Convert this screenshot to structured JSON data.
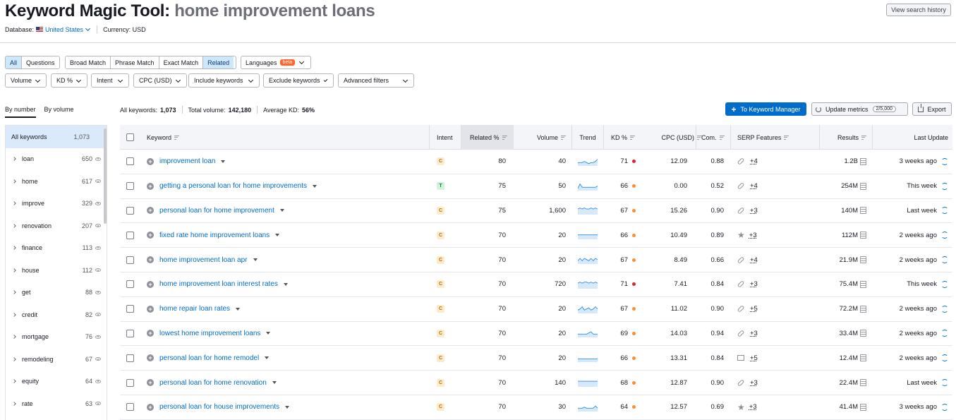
{
  "header": {
    "title_prefix": "Keyword Magic Tool:",
    "title_query": "home improvement loans",
    "database_label": "Database:",
    "database_value": "United States",
    "currency_label": "Currency: USD",
    "history_button": "View search history"
  },
  "match_tabs": [
    {
      "label": "All",
      "active": true
    },
    {
      "label": "Questions",
      "active": false
    }
  ],
  "match_types": [
    {
      "label": "Broad Match",
      "active": false
    },
    {
      "label": "Phrase Match",
      "active": false
    },
    {
      "label": "Exact Match",
      "active": false
    },
    {
      "label": "Related",
      "active": true
    }
  ],
  "languages": {
    "label": "Languages",
    "badge": "beta"
  },
  "filters": [
    "Volume",
    "KD %",
    "Intent",
    "CPC (USD)",
    "Include keywords",
    "Exclude keywords",
    "Advanced filters"
  ],
  "group_tabs": [
    {
      "label": "By number",
      "active": true
    },
    {
      "label": "By volume",
      "active": false
    }
  ],
  "sidebar": {
    "all": {
      "label": "All keywords",
      "count": "1,073"
    },
    "items": [
      {
        "label": "loan",
        "count": "650"
      },
      {
        "label": "home",
        "count": "617"
      },
      {
        "label": "improve",
        "count": "329"
      },
      {
        "label": "renovation",
        "count": "207"
      },
      {
        "label": "finance",
        "count": "113"
      },
      {
        "label": "house",
        "count": "112"
      },
      {
        "label": "get",
        "count": "88"
      },
      {
        "label": "credit",
        "count": "82"
      },
      {
        "label": "mortgage",
        "count": "76"
      },
      {
        "label": "remodeling",
        "count": "67"
      },
      {
        "label": "equity",
        "count": "64"
      },
      {
        "label": "rate",
        "count": "63"
      }
    ]
  },
  "stats": {
    "all_label": "All keywords:",
    "all_value": "1,073",
    "volume_label": "Total volume:",
    "volume_value": "142,180",
    "kd_label": "Average KD:",
    "kd_value": "56%"
  },
  "actions": {
    "keyword_manager": "To Keyword Manager",
    "update_metrics": "Update metrics",
    "update_count": "2/5,000",
    "export": "Export"
  },
  "columns": {
    "keyword": "Keyword",
    "intent": "Intent",
    "related": "Related %",
    "volume": "Volume",
    "trend": "Trend",
    "kd": "KD %",
    "cpc": "CPC (USD)",
    "com": "Com.",
    "serp": "SERP Features",
    "results": "Results",
    "last_update": "Last Update"
  },
  "colors": {
    "accent": "#006dca",
    "intent_c_bg": "#fcecce",
    "intent_c_fg": "#b57000",
    "intent_t_bg": "#d2f2dc",
    "intent_t_fg": "#00873c",
    "kd_red": "#e0213a",
    "kd_orange": "#ff8c2e"
  },
  "rows": [
    {
      "keyword": "improvement loan",
      "intent": "C",
      "related": "80",
      "volume": "40",
      "kd": "71",
      "kd_level": "red",
      "cpc": "12.09",
      "com": "0.88",
      "serp_icon": "link-icon",
      "serp_more": "+4",
      "results": "1.2B",
      "updated": "3 weeks ago",
      "trend": [
        3,
        3,
        3,
        4,
        3,
        2,
        3,
        3,
        4,
        6
      ]
    },
    {
      "keyword": "getting a personal loan for home improvements",
      "intent": "T",
      "related": "75",
      "volume": "50",
      "kd": "66",
      "kd_level": "orange",
      "cpc": "0.00",
      "com": "0.52",
      "serp_icon": "link-icon",
      "serp_more": "+4",
      "results": "254M",
      "updated": "This week",
      "trend": [
        2,
        6,
        3,
        3,
        3,
        3,
        3,
        3,
        3,
        4
      ]
    },
    {
      "keyword": "personal loan for home improvement",
      "intent": "C",
      "related": "75",
      "volume": "1,600",
      "kd": "67",
      "kd_level": "orange",
      "cpc": "15.26",
      "com": "0.90",
      "serp_icon": "link-icon",
      "serp_more": "+3",
      "results": "140M",
      "updated": "Last week",
      "trend": [
        5,
        6,
        5,
        6,
        5,
        5,
        6,
        5,
        6,
        5
      ]
    },
    {
      "keyword": "fixed rate home improvement loans",
      "intent": "C",
      "related": "70",
      "volume": "20",
      "kd": "66",
      "kd_level": "orange",
      "cpc": "10.49",
      "com": "0.89",
      "serp_icon": "star-icon",
      "serp_more": "+3",
      "results": "112M",
      "updated": "2 weeks ago",
      "trend": [
        4,
        4,
        4,
        4,
        4,
        4,
        4,
        4,
        4,
        4
      ]
    },
    {
      "keyword": "home improvement loan apr",
      "intent": "C",
      "related": "70",
      "volume": "20",
      "kd": "67",
      "kd_level": "orange",
      "cpc": "8.49",
      "com": "0.66",
      "serp_icon": "link-icon",
      "serp_more": "+4",
      "results": "21.9M",
      "updated": "2 weeks ago",
      "trend": [
        3,
        5,
        3,
        5,
        4,
        3,
        5,
        3,
        5,
        4
      ]
    },
    {
      "keyword": "home improvement loan interest rates",
      "intent": "C",
      "related": "70",
      "volume": "720",
      "kd": "71",
      "kd_level": "red",
      "cpc": "7.41",
      "com": "0.84",
      "serp_icon": "link-icon",
      "serp_more": "+3",
      "results": "75.4M",
      "updated": "This week",
      "trend": [
        5,
        6,
        5,
        6,
        6,
        5,
        6,
        5,
        6,
        5
      ]
    },
    {
      "keyword": "home repair loan rates",
      "intent": "C",
      "related": "70",
      "volume": "20",
      "kd": "67",
      "kd_level": "orange",
      "cpc": "11.02",
      "com": "0.90",
      "serp_icon": "link-icon",
      "serp_more": "+5",
      "results": "72.2M",
      "updated": "2 weeks ago",
      "trend": [
        3,
        4,
        6,
        3,
        4,
        5,
        3,
        4,
        6,
        4
      ]
    },
    {
      "keyword": "lowest home improvement loans",
      "intent": "C",
      "related": "70",
      "volume": "20",
      "kd": "69",
      "kd_level": "orange",
      "cpc": "14.03",
      "com": "0.94",
      "serp_icon": "link-icon",
      "serp_more": "+3",
      "results": "33.4M",
      "updated": "2 weeks ago",
      "trend": [
        3,
        3,
        3,
        3,
        3,
        4,
        5,
        3,
        3,
        3
      ]
    },
    {
      "keyword": "personal loan for home remodel",
      "intent": "C",
      "related": "70",
      "volume": "20",
      "kd": "66",
      "kd_level": "orange",
      "cpc": "13.31",
      "com": "0.84",
      "serp_icon": "image-icon",
      "serp_more": "+5",
      "results": "12.4M",
      "updated": "2 weeks ago",
      "trend": [
        3,
        3,
        3,
        3,
        3,
        3,
        3,
        3,
        3,
        3
      ]
    },
    {
      "keyword": "personal loan for home renovation",
      "intent": "C",
      "related": "70",
      "volume": "140",
      "kd": "68",
      "kd_level": "orange",
      "cpc": "12.87",
      "com": "0.90",
      "serp_icon": "link-icon",
      "serp_more": "+3",
      "results": "22.4M",
      "updated": "Last week",
      "trend": [
        5,
        5,
        5,
        5,
        5,
        5,
        5,
        5,
        5,
        5
      ]
    },
    {
      "keyword": "personal loan for house improvements",
      "intent": "C",
      "related": "70",
      "volume": "30",
      "kd": "64",
      "kd_level": "orange",
      "cpc": "12.57",
      "com": "0.69",
      "serp_icon": "star-icon",
      "serp_more": "+3",
      "results": "41.4M",
      "updated": "3 weeks ago",
      "trend": [
        3,
        3,
        3,
        4,
        3,
        3,
        3,
        3,
        5,
        3
      ]
    }
  ]
}
